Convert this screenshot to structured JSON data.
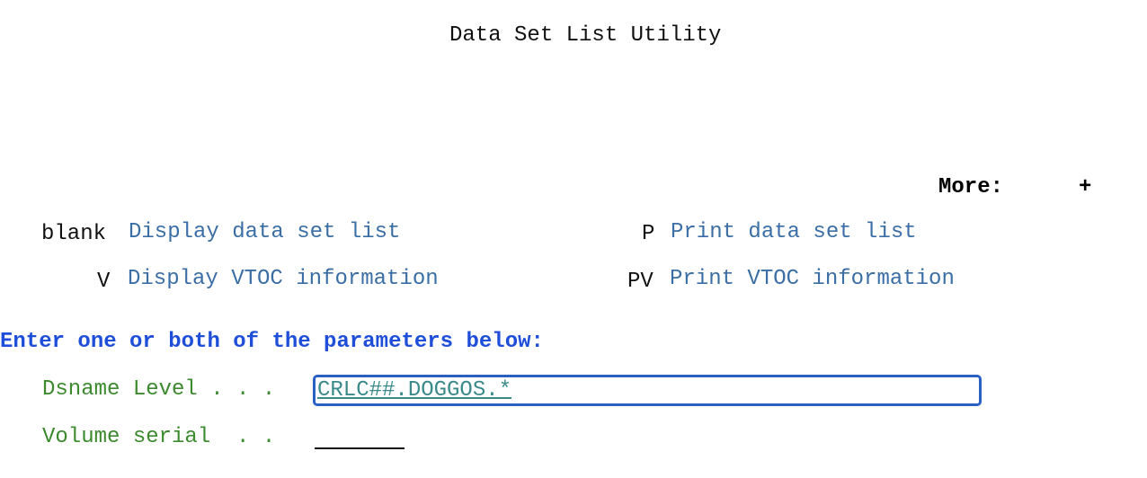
{
  "screen": {
    "title": "Data Set List Utility",
    "more_label": "More:",
    "more_indicator": "+"
  },
  "options": [
    {
      "key": "blank",
      "description": "Display data set list"
    },
    {
      "key": "P",
      "description": "Print data set list"
    },
    {
      "key": "V",
      "description": "Display VTOC information"
    },
    {
      "key": "PV",
      "description": "Print VTOC information"
    }
  ],
  "form": {
    "instruction": "Enter one or both of the parameters below:",
    "dsname_label": "Dsname Level . . .",
    "dsname_value": "CRLC##.DOGGOS.*",
    "volser_label": "Volume serial  . .",
    "volser_value": ""
  },
  "colors": {
    "text": "#111111",
    "option_desc": "#3a6ea5",
    "field_label": "#3c8a2e",
    "instruction": "#1f4fd8",
    "field_focus_border": "#2a5fc4"
  }
}
